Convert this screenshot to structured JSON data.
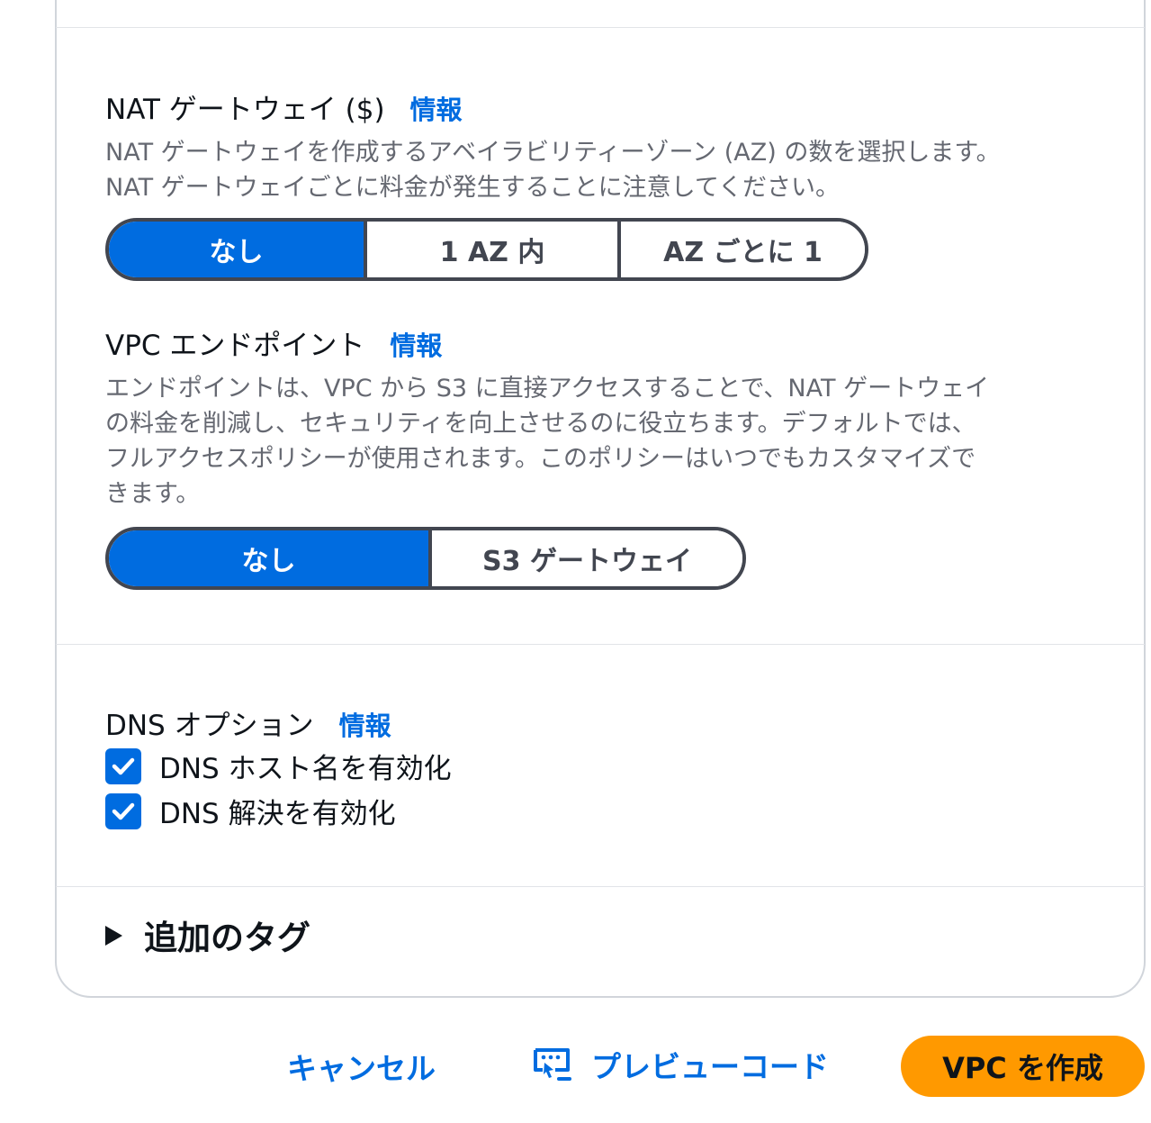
{
  "nat_gateway": {
    "title": "NAT ゲートウェイ ($)",
    "info": "情報",
    "description_line1": "NAT ゲートウェイを作成するアベイラビリティーゾーン (AZ) の数を選択します。",
    "description_line2": "NAT ゲートウェイごとに料金が発生することに注意してください。",
    "options": [
      "なし",
      "1 AZ 内",
      "AZ ごとに 1"
    ],
    "selected": "なし"
  },
  "vpc_endpoint": {
    "title": "VPC エンドポイント",
    "info": "情報",
    "description_line1": "エンドポイントは、VPC から S3 に直接アクセスすることで、NAT ゲートウェイ",
    "description_line2": "の料金を削減し、セキュリティを向上させるのに役立ちます。デフォルトでは、",
    "description_line3": "フルアクセスポリシーが使用されます。このポリシーはいつでもカスタマイズで",
    "description_line4": "きます。",
    "options": [
      "なし",
      "S3 ゲートウェイ"
    ],
    "selected": "なし"
  },
  "dns_options": {
    "title": "DNS オプション",
    "info": "情報",
    "hostnames_label": "DNS ホスト名を有効化",
    "hostnames_checked": true,
    "resolution_label": "DNS 解決を有効化",
    "resolution_checked": true
  },
  "additional_tags": {
    "label": "追加のタグ",
    "icon": "caret-right-icon"
  },
  "footer": {
    "cancel": "キャンセル",
    "preview_code": "プレビューコード",
    "preview_icon": "code-preview-icon",
    "create": "VPC を作成"
  },
  "colors": {
    "accent": "#006ce0",
    "primary_button": "#ff9900",
    "segment_border": "#424650",
    "description_text": "#656871"
  }
}
